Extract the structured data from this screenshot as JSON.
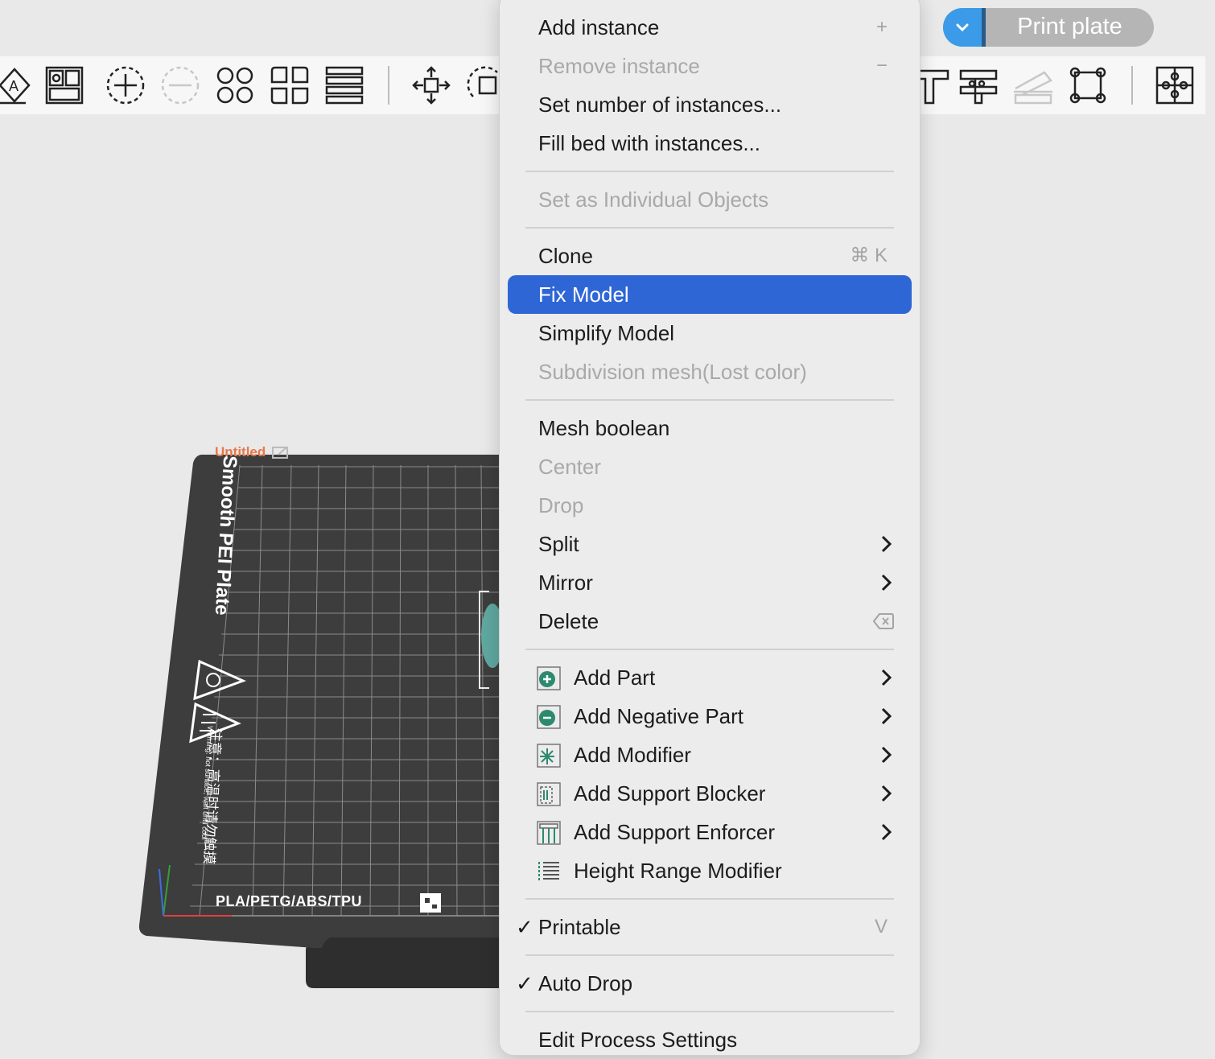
{
  "print_plate": {
    "label": "Print plate"
  },
  "plate": {
    "name": "Untitled",
    "surface_label": "Smooth PEI Plate",
    "material_label": "PLA/PETG/ABS/TPU",
    "warning_cn": "注意：高温时请勿触摸",
    "warning_en": "Warning: hot surface, wait until cool"
  },
  "toolbar": {
    "icons": [
      "auto-orient-icon",
      "arrange-icon",
      "add-instance-icon",
      "remove-instance-icon",
      "split-objects-icon",
      "split-parts-icon",
      "layers-icon",
      "move-icon",
      "rotate-icon",
      "support-paint-icon",
      "measure-icon",
      "cut-icon",
      "scale-icon",
      "assembly-icon"
    ]
  },
  "menu": {
    "add_instance": "Add instance",
    "add_instance_sc": "+",
    "remove_instance": "Remove instance",
    "remove_instance_sc": "−",
    "set_number": "Set number of instances...",
    "fill_bed": "Fill bed with instances...",
    "set_individual": "Set as Individual Objects",
    "clone": "Clone",
    "clone_sc": "⌘ K",
    "fix_model": "Fix Model",
    "simplify": "Simplify Model",
    "subdivision": "Subdivision mesh(Lost color)",
    "mesh_boolean": "Mesh boolean",
    "center": "Center",
    "drop": "Drop",
    "split": "Split",
    "mirror": "Mirror",
    "delete": "Delete",
    "add_part": "Add Part",
    "add_negative": "Add Negative Part",
    "add_modifier": "Add Modifier",
    "add_support_blocker": "Add Support Blocker",
    "add_support_enforcer": "Add Support Enforcer",
    "height_range": "Height Range Modifier",
    "printable": "Printable",
    "printable_sc": "V",
    "auto_drop": "Auto Drop",
    "edit_process": "Edit Process Settings",
    "checkmark": "✓"
  }
}
